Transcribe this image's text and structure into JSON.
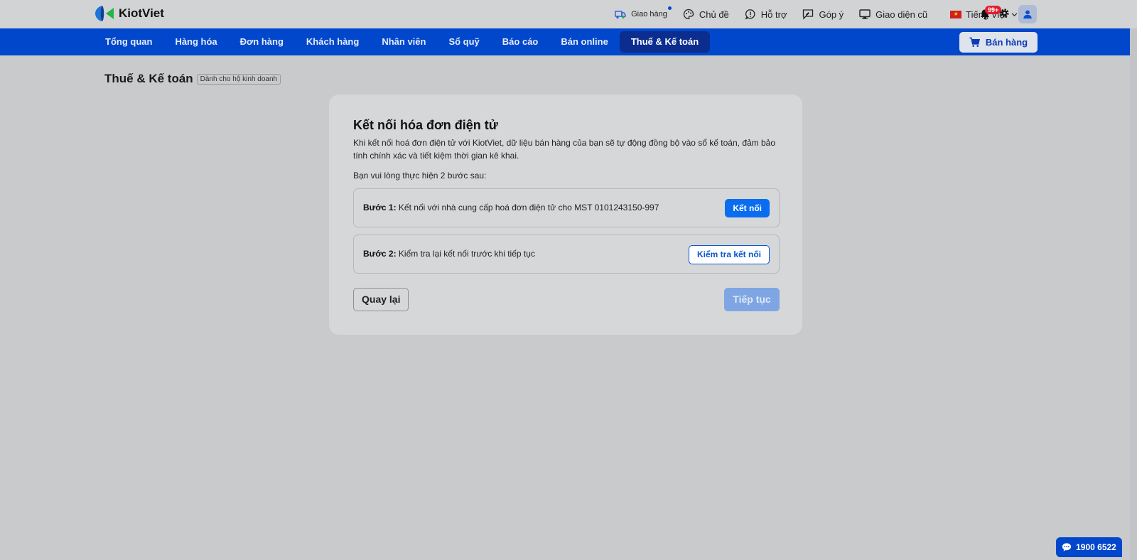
{
  "app": {
    "name": "KiotViet"
  },
  "topbar": {
    "actions": [
      {
        "label": "Giao hàng",
        "icon": "delivery-icon"
      },
      {
        "label": "Chủ đề",
        "icon": "palette-icon"
      },
      {
        "label": "Hỗ trợ",
        "icon": "help-icon"
      },
      {
        "label": "Góp ý",
        "icon": "feedback-icon"
      },
      {
        "label": "Giao diện cũ",
        "icon": "monitor-icon"
      }
    ],
    "language": "Tiếng Việt",
    "notification_count": "99+"
  },
  "nav": {
    "items": [
      {
        "label": "Tổng quan"
      },
      {
        "label": "Hàng hóa"
      },
      {
        "label": "Đơn hàng"
      },
      {
        "label": "Khách hàng"
      },
      {
        "label": "Nhân viên"
      },
      {
        "label": "Sổ quỹ"
      },
      {
        "label": "Báo cáo"
      },
      {
        "label": "Bán online"
      },
      {
        "label": "Thuế & Kế toán",
        "active": true
      }
    ],
    "sell_button": "Bán hàng"
  },
  "page": {
    "title": "Thuế & Kế toán",
    "tag": "Dành cho hộ kinh doanh"
  },
  "card": {
    "title": "Kết nối hóa đơn điện tử",
    "description": "Khi kết nối hoá đơn điện tử với KiotViet, dữ liệu bán hàng của bạn sẽ tự động đồng bộ vào sổ kế toán, đảm bảo tính chính xác và tiết kiệm thời gian kê khai.",
    "subtitle": "Bạn vui lòng thực hiện 2 bước sau:",
    "step1": {
      "label": "Bước 1:",
      "text": "Kết nối với nhà cung cấp hoá đơn điện tử cho MST 0101243150-997",
      "button": "Kết nối"
    },
    "step2": {
      "label": "Bước 2:",
      "text": "Kiểm tra lại kết nối trước khi tiếp tục",
      "button": "Kiểm tra kết nối"
    },
    "back_button": "Quay lại",
    "next_button": "Tiếp tục"
  },
  "hotline": "1900 6522",
  "colors": {
    "primary": "#0047cc",
    "active_nav": "#0a2d8f",
    "button_blue": "#0a6df0",
    "badge_red": "#e11d2e"
  }
}
